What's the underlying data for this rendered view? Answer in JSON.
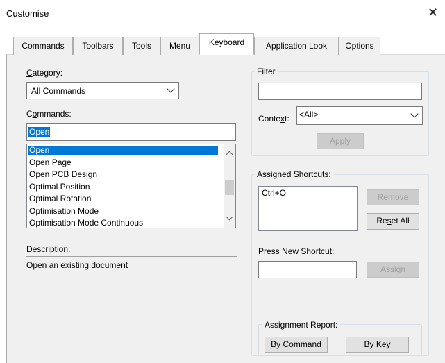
{
  "window": {
    "title": "Customise",
    "close_glyph": "✕"
  },
  "tabs": [
    {
      "label": "Commands"
    },
    {
      "label": "Toolbars"
    },
    {
      "label": "Tools"
    },
    {
      "label": "Menu"
    },
    {
      "label": "Keyboard"
    },
    {
      "label": "Application Look"
    },
    {
      "label": "Options"
    }
  ],
  "category": {
    "label_first": "C",
    "label_rest": "ategory:",
    "value": "All Commands"
  },
  "commands": {
    "label_first": "C",
    "label_mid": "o",
    "label_rest": "mmands:",
    "search_value": "Open",
    "items": [
      {
        "label": "Open"
      },
      {
        "label": "Open Page"
      },
      {
        "label": "Open PCB Design"
      },
      {
        "label": "Optimal Position"
      },
      {
        "label": "Optimal Rotation"
      },
      {
        "label": "Optimisation Mode"
      },
      {
        "label": "Optimisation Mode Continuous"
      }
    ]
  },
  "description": {
    "label": "Description:",
    "text": "Open an existing document"
  },
  "filter": {
    "title": "Filter",
    "value": "",
    "context_label_pre": "Conte",
    "context_label_u": "x",
    "context_label_post": "t:",
    "context_value": "<All>",
    "apply_label": "Apply"
  },
  "assigned": {
    "title": "Assigned Shortcuts:",
    "items": [
      {
        "label": "Ctrl+O"
      }
    ],
    "remove_u": "R",
    "remove_rest": "emove",
    "reset_pre": "Re",
    "reset_u": "s",
    "reset_post": "et All",
    "press_pre": "Press ",
    "press_u": "N",
    "press_post": "ew Shortcut:",
    "new_shortcut_value": "",
    "assign_u": "A",
    "assign_rest": "ssign"
  },
  "report": {
    "title": "Assignment Report:",
    "by_command": "By Command",
    "by_key": "By Key"
  }
}
